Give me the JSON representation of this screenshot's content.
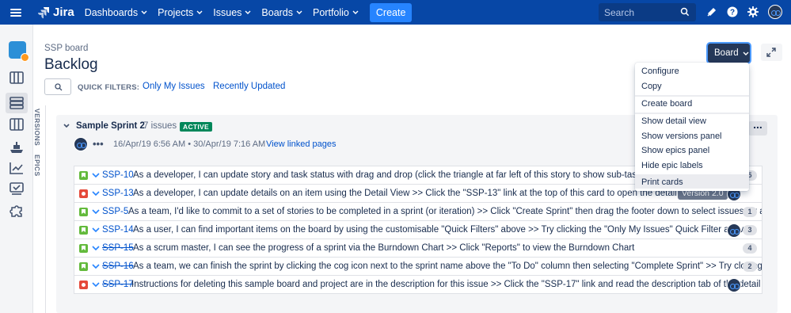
{
  "topnav": {
    "logo": "Jira",
    "items": [
      "Dashboards",
      "Projects",
      "Issues",
      "Boards",
      "Portfolio"
    ],
    "create": "Create",
    "search_placeholder": "Search"
  },
  "header": {
    "breadcrumb": "SSP board",
    "title": "Backlog",
    "quick_filters_label": "QUICK FILTERS:",
    "filters": [
      "Only My Issues",
      "Recently Updated"
    ],
    "board_button": "Board"
  },
  "side_tabs": [
    "VERSIONS",
    "EPICS"
  ],
  "sprint": {
    "name": "Sample Sprint 2",
    "count": "7 issues",
    "status": "ACTIVE",
    "start": "16/Apr/19 6:56 AM",
    "end": "30/Apr/19 7:16 AM",
    "dates_sep": "•",
    "linked": "View linked pages"
  },
  "issues": [
    {
      "key": "SSP-10",
      "type": "story",
      "done": false,
      "summary": "As a developer, I can update story and task status with drag and drop (click the triangle at far left of this story to show sub-tasks)",
      "estimate": "5"
    },
    {
      "key": "SSP-13",
      "type": "bug",
      "done": false,
      "summary": "As a developer, I can update details on an item using the Detail View >> Click the \"SSP-13\" link at the top of this card to open the detail view",
      "version": "Version 2.0"
    },
    {
      "key": "SSP-5",
      "type": "story",
      "done": false,
      "summary": "As a team, I'd like to commit to a set of stories to be completed in a sprint (or iteration) >> Click \"Create Sprint\" then drag the footer down to select issues for a sprint (y",
      "estimate": "1"
    },
    {
      "key": "SSP-14",
      "type": "story",
      "done": false,
      "summary": "As a user, I can find important items on the board by using the customisable \"Quick Filters\" above >> Try clicking the \"Only My Issues\" Quick Filter above",
      "estimate": "3"
    },
    {
      "key": "SSP-15",
      "type": "story",
      "done": true,
      "summary": "As a scrum master, I can see the progress of a sprint via the Burndown Chart >> Click \"Reports\" to view the Burndown Chart",
      "estimate": "4"
    },
    {
      "key": "SSP-16",
      "type": "story",
      "done": true,
      "summary": "As a team, we can finish the sprint by clicking the cog icon next to the sprint name above the \"To Do\" column then selecting \"Complete Sprint\" >> Try closing this sprin",
      "estimate": "2"
    },
    {
      "key": "SSP-17",
      "type": "bug",
      "done": true,
      "summary": "Instructions for deleting this sample board and project are in the description for this issue >> Click the \"SSP-17\" link and read the description tab of the detail view"
    }
  ],
  "dropdown": {
    "items": [
      "Configure",
      "Copy",
      "Create board",
      "Show detail view",
      "Show versions panel",
      "Show epics panel",
      "Hide epic labels",
      "Print cards"
    ]
  },
  "colors": {
    "nav": "#0747a6",
    "link": "#0052cc",
    "active": "#00875a"
  }
}
